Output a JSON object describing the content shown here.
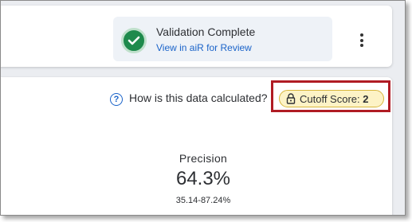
{
  "status": {
    "title": "Validation Complete",
    "link": "View in aiR for Review",
    "color": "#1e8a4c"
  },
  "help": {
    "text": "How is this data calculated?"
  },
  "cutoff": {
    "label": "Cutoff Score:",
    "value": "2",
    "badge_color": "#fdf3c6",
    "highlight_color": "#b01c24"
  },
  "metric": {
    "label": "Precision",
    "value": "64.3%",
    "range": "35.14-87.24%"
  },
  "icons": {
    "status": "check-circle-icon",
    "menu": "more-vertical-icon",
    "help": "question-circle-icon",
    "cutoff": "lock-icon"
  }
}
